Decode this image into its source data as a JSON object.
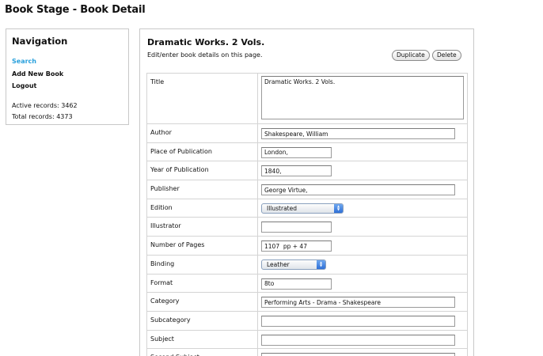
{
  "page": {
    "title": "Book Stage - Book Detail"
  },
  "navigation": {
    "heading": "Navigation",
    "links": [
      {
        "label": "Search",
        "active": true
      },
      {
        "label": "Add New Book",
        "active": false
      },
      {
        "label": "Logout",
        "active": false
      }
    ],
    "stats": {
      "active": "Active records: 3462",
      "total": "Total records: 4373"
    }
  },
  "book": {
    "title": "Dramatic Works. 2 Vols.",
    "subtitle": "Edit/enter book details on this page.",
    "buttons": {
      "duplicate": "Duplicate",
      "delete": "Delete"
    },
    "fields": {
      "title": {
        "label": "Title",
        "value": "Dramatic Works. 2 Vols."
      },
      "author": {
        "label": "Author",
        "value": "Shakespeare, William"
      },
      "place": {
        "label": "Place of Publication",
        "value": "London,"
      },
      "year": {
        "label": "Year of Publication",
        "value": "1840,"
      },
      "publisher": {
        "label": "Publisher",
        "value": "George Virtue,"
      },
      "edition": {
        "label": "Edition",
        "value": "Illustrated"
      },
      "illustrator": {
        "label": "Illustrator",
        "value": ""
      },
      "pages": {
        "label": "Number of Pages",
        "value": "1107  pp + 47"
      },
      "binding": {
        "label": "Binding",
        "value": "Leather"
      },
      "format": {
        "label": "Format",
        "value": "8to"
      },
      "category": {
        "label": "Category",
        "value": "Performing Arts - Drama - Shakespeare"
      },
      "subcategory": {
        "label": "Subcategory",
        "value": ""
      },
      "subject": {
        "label": "Subject",
        "value": ""
      },
      "second_subject": {
        "label": "Second Subject",
        "value": ""
      }
    }
  },
  "colors": {
    "link_active": "#29a0dc",
    "border": "#c8c8c8",
    "select_arrow": "#2e6fd6"
  },
  "icons": {
    "select_arrow": "updown-arrows-icon"
  }
}
